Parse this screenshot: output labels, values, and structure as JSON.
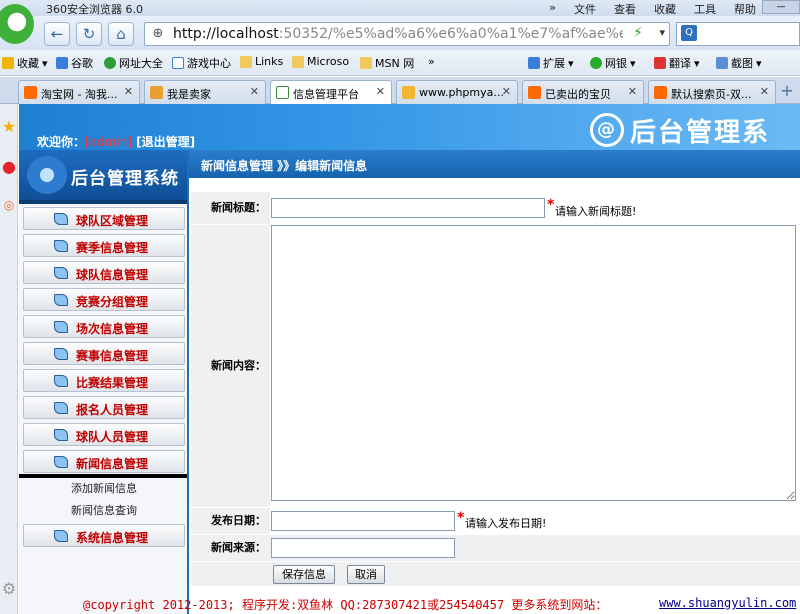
{
  "browser": {
    "title": "360安全浏览器 6.0",
    "menu": [
      "»",
      "文件",
      "查看",
      "收藏",
      "工具",
      "帮助"
    ],
    "address_host": "http://localhost",
    "address_rest": ":50352/%e5%ad%a6%e6%a0%a1%e7%af%ae%e7%90%",
    "bookmarks": [
      "收藏",
      "谷歌",
      "网址大全",
      "游戏中心",
      "Links",
      "Microso",
      "MSN 网",
      "»",
      "扩展",
      "网银",
      "翻译",
      "截图"
    ],
    "tabs": [
      {
        "label": "淘宝网 - 淘我...",
        "active": false
      },
      {
        "label": "我是卖家",
        "active": false
      },
      {
        "label": "信息管理平台",
        "active": true
      },
      {
        "label": "www.phpmya...",
        "active": false
      },
      {
        "label": "已卖出的宝贝",
        "active": false
      },
      {
        "label": "默认搜索页-双...",
        "active": false
      }
    ],
    "new_tab": "+"
  },
  "header": {
    "welcome_prefix": "欢迎你：",
    "user": "[admin]",
    "logout": "[退出管理]",
    "logo_text": "后台管理系",
    "logo_symbol": "@"
  },
  "sidebar": {
    "title": "后台管理系统",
    "items": [
      "球队区域管理",
      "赛季信息管理",
      "球队信息管理",
      "竞赛分组管理",
      "场次信息管理",
      "赛事信息管理",
      "比赛结果管理",
      "报名人员管理",
      "球队人员管理",
      "新闻信息管理"
    ],
    "subitems": [
      "添加新闻信息",
      "新闻信息查询"
    ],
    "last_item": "系统信息管理"
  },
  "breadcrumb": "新闻信息管理 》》编辑新闻信息",
  "form": {
    "title_label": "新闻标题：",
    "title_value": "",
    "title_hint": "请输入新闻标题!",
    "content_label": "新闻内容：",
    "content_value": "",
    "date_label": "发布日期：",
    "date_value": "",
    "date_hint": "请输入发布日期!",
    "source_label": "新闻来源：",
    "source_value": "",
    "required_mark": "*",
    "save_button": "保存信息",
    "cancel_button": "取消"
  },
  "footer": {
    "text": "@copyright 2012-2013; 程序开发:双鱼林  QQ:287307421或254540457  更多系统到网站：",
    "link": "www.shuangyulin.com"
  },
  "colors": {
    "banner": "#1f7fd0",
    "menu_text": "#c00000",
    "required": "#d00000",
    "footer_text": "#c00000"
  }
}
